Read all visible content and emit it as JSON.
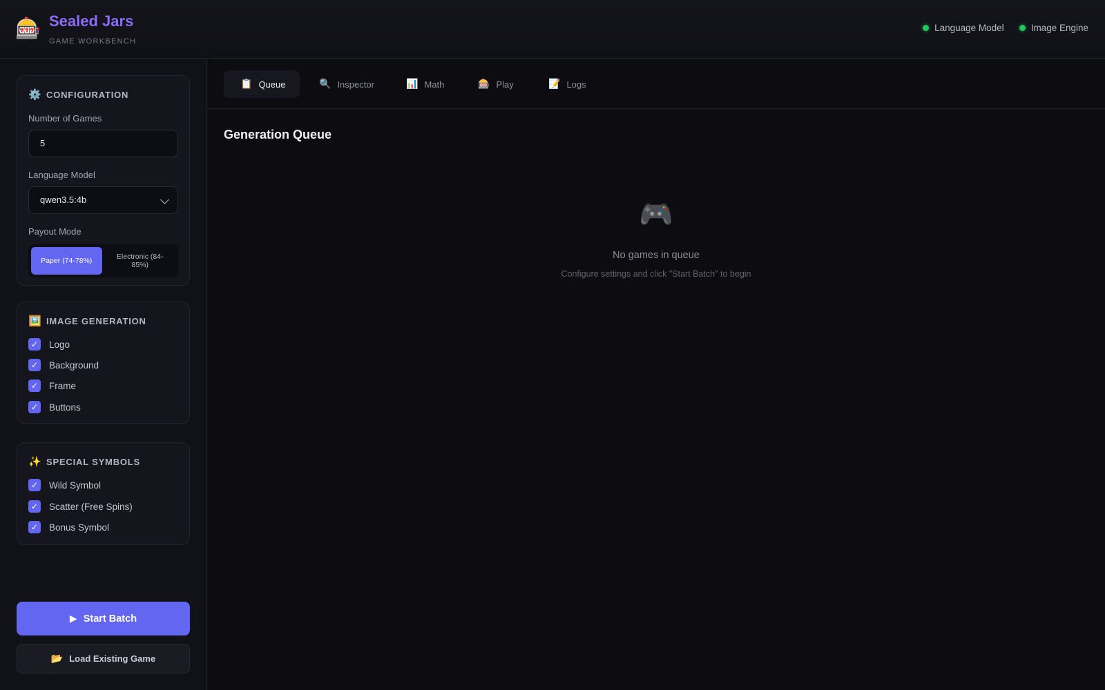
{
  "header": {
    "brand_icon": "slot-machine-icon",
    "brand_glyph": "🎰",
    "title": "Sealed Jars",
    "subtitle": "GAME WORKBENCH",
    "status": [
      {
        "label": "Language Model",
        "color": "#22c55e"
      },
      {
        "label": "Image Engine",
        "color": "#22c55e"
      }
    ]
  },
  "sidebar": {
    "configuration": {
      "icon": "gear-icon",
      "glyph": "⚙️",
      "title": "CONFIGURATION",
      "games_label": "Number of Games",
      "games_value": "5",
      "model_label": "Language Model",
      "model_value": "qwen3.5:4b",
      "payout_label": "Payout Mode",
      "payout_options": [
        {
          "label": "Paper (74-78%)",
          "selected": true
        },
        {
          "label": "Electronic (84-85%)",
          "selected": false
        }
      ]
    },
    "image_generation": {
      "icon": "picture-icon",
      "glyph": "🖼️",
      "title": "IMAGE GENERATION",
      "items": [
        {
          "label": "Logo",
          "checked": true
        },
        {
          "label": "Background",
          "checked": true
        },
        {
          "label": "Frame",
          "checked": true
        },
        {
          "label": "Buttons",
          "checked": true
        }
      ]
    },
    "special_symbols": {
      "icon": "sparkles-icon",
      "glyph": "✨",
      "title": "SPECIAL SYMBOLS",
      "items": [
        {
          "label": "Wild Symbol",
          "checked": true
        },
        {
          "label": "Scatter (Free Spins)",
          "checked": true
        },
        {
          "label": "Bonus Symbol",
          "checked": true
        }
      ]
    },
    "start_button": {
      "icon": "play-icon",
      "glyph": "▶",
      "label": "Start Batch"
    },
    "load_button": {
      "icon": "open-folder-icon",
      "glyph": "📂",
      "label": "Load Existing Game"
    },
    "check_glyph": "✓"
  },
  "main": {
    "tabs": [
      {
        "label": "Queue",
        "icon": "clipboard-icon",
        "glyph": "📋",
        "active": true
      },
      {
        "label": "Inspector",
        "icon": "magnifier-icon",
        "glyph": "🔍",
        "active": false
      },
      {
        "label": "Math",
        "icon": "bar-chart-icon",
        "glyph": "📊",
        "active": false
      },
      {
        "label": "Play",
        "icon": "slot-machine-icon",
        "glyph": "🎰",
        "active": false
      },
      {
        "label": "Logs",
        "icon": "memo-icon",
        "glyph": "📝",
        "active": false
      }
    ],
    "section_title": "Generation Queue",
    "empty": {
      "icon": "game-controller-icon",
      "glyph": "🎮",
      "title": "No games in queue",
      "subtitle": "Configure settings and click \"Start Batch\" to begin"
    }
  },
  "colors": {
    "accent": "#6366f1",
    "brand": "#8b6cf6",
    "status_ok": "#22c55e",
    "background": "#0c0c11"
  }
}
